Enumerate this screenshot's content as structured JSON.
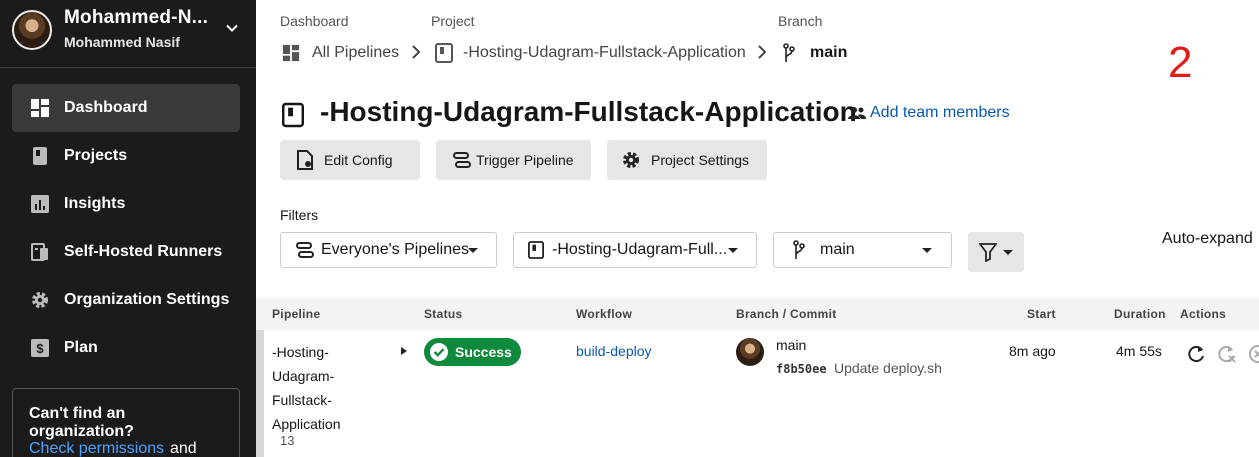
{
  "sidebar": {
    "org_name": "Mohammed-N...",
    "org_user": "Mohammed Nasif",
    "items": [
      {
        "label": "Dashboard",
        "icon": "dashboard-icon"
      },
      {
        "label": "Projects",
        "icon": "projects-icon"
      },
      {
        "label": "Insights",
        "icon": "insights-icon"
      },
      {
        "label": "Self-Hosted Runners",
        "icon": "runners-icon"
      },
      {
        "label": "Organization Settings",
        "icon": "gear-icon"
      },
      {
        "label": "Plan",
        "icon": "dollar-icon"
      }
    ],
    "notice": {
      "title": "Can't find an organization?",
      "link": "Check permissions",
      "trailing": "and"
    }
  },
  "breadcrumb": {
    "dashboard_label": "Dashboard",
    "dashboard_value": "All Pipelines",
    "project_label": "Project",
    "project_value": "-Hosting-Udagram-Fullstack-Application",
    "branch_label": "Branch",
    "branch_value": "main"
  },
  "annotation": "2",
  "project": {
    "title": "-Hosting-Udagram-Fullstack-Application",
    "add_team": "Add team members"
  },
  "toolbar": {
    "edit_config": "Edit Config",
    "trigger_pipeline": "Trigger Pipeline",
    "project_settings": "Project Settings"
  },
  "filters": {
    "label": "Filters",
    "pipelines": "Everyone's Pipelines",
    "project": "-Hosting-Udagram-Full...",
    "branch": "main",
    "auto_expand": "Auto-expand"
  },
  "table": {
    "headers": {
      "pipeline": "Pipeline",
      "status": "Status",
      "workflow": "Workflow",
      "branch_commit": "Branch / Commit",
      "start": "Start",
      "duration": "Duration",
      "actions": "Actions"
    },
    "rows": [
      {
        "pipeline_lines": [
          "-Hosting-",
          "Udagram-",
          "Fullstack-",
          "Application"
        ],
        "number": "13",
        "status": "Success",
        "workflow": "build-deploy",
        "branch": "main",
        "commit_hash": "f8b50ee",
        "commit_msg": "Update deploy.sh",
        "start": "8m ago",
        "duration": "4m 55s"
      }
    ]
  },
  "colors": {
    "sidebar_bg": "#1b1b1b",
    "success": "#0e8a3d",
    "link": "#0a58b3",
    "annotation": "#e21b1b"
  }
}
